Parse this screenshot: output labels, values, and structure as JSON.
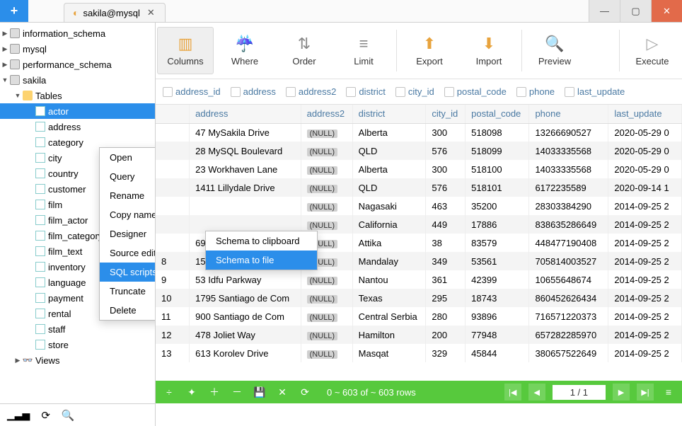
{
  "tab_title": "sakila@mysql",
  "sidebar": {
    "databases": [
      "information_schema",
      "mysql",
      "performance_schema",
      "sakila"
    ],
    "folder_tables": "Tables",
    "tables": [
      "actor",
      "address",
      "category",
      "city",
      "country",
      "customer",
      "film",
      "film_actor",
      "film_category",
      "film_text",
      "inventory",
      "language",
      "payment",
      "rental",
      "staff",
      "store"
    ],
    "folder_views": "Views"
  },
  "toolbar": {
    "columns": "Columns",
    "where": "Where",
    "order": "Order",
    "limit": "Limit",
    "export": "Export",
    "import": "Import",
    "preview": "Preview",
    "execute": "Execute"
  },
  "column_checks": [
    "address_id",
    "address",
    "address2",
    "district",
    "city_id",
    "postal_code",
    "phone",
    "last_update"
  ],
  "grid": {
    "headers": [
      "",
      "address",
      "address2",
      "district",
      "city_id",
      "postal_code",
      "phone",
      "last_update"
    ],
    "rows": [
      [
        "",
        "47 MySakila Drive",
        "(NULL)",
        "Alberta",
        "300",
        "518098",
        "13266690527",
        "2020-05-29 0"
      ],
      [
        "",
        "28 MySQL Boulevard",
        "(NULL)",
        "QLD",
        "576",
        "518099",
        "14033335568",
        "2020-05-29 0"
      ],
      [
        "",
        "23 Workhaven Lane",
        "(NULL)",
        "Alberta",
        "300",
        "518100",
        "14033335568",
        "2020-05-29 0"
      ],
      [
        "",
        "1411 Lillydale Drive",
        "(NULL)",
        "QLD",
        "576",
        "518101",
        "6172235589",
        "2020-09-14 1"
      ],
      [
        "",
        "",
        "(NULL)",
        "Nagasaki",
        "463",
        "35200",
        "28303384290",
        "2014-09-25 2"
      ],
      [
        "",
        "",
        "(NULL)",
        "California",
        "449",
        "17886",
        "838635286649",
        "2014-09-25 2"
      ],
      [
        "",
        "692 Joliet Street",
        "(NULL)",
        "Attika",
        "38",
        "83579",
        "448477190408",
        "2014-09-25 2"
      ],
      [
        "8",
        "1566 Inegl Manor",
        "(NULL)",
        "Mandalay",
        "349",
        "53561",
        "705814003527",
        "2014-09-25 2"
      ],
      [
        "9",
        "53 Idfu Parkway",
        "(NULL)",
        "Nantou",
        "361",
        "42399",
        "10655648674",
        "2014-09-25 2"
      ],
      [
        "10",
        "1795 Santiago de Com",
        "(NULL)",
        "Texas",
        "295",
        "18743",
        "860452626434",
        "2014-09-25 2"
      ],
      [
        "11",
        "900 Santiago de Com",
        "(NULL)",
        "Central Serbia",
        "280",
        "93896",
        "716571220373",
        "2014-09-25 2"
      ],
      [
        "12",
        "478 Joliet Way",
        "(NULL)",
        "Hamilton",
        "200",
        "77948",
        "657282285970",
        "2014-09-25 2"
      ],
      [
        "13",
        "613 Korolev Drive",
        "(NULL)",
        "Masqat",
        "329",
        "45844",
        "380657522649",
        "2014-09-25 2"
      ]
    ]
  },
  "context_menu": {
    "items": [
      "Open",
      "Query",
      "Rename",
      "Copy name",
      "Designer",
      "Source editor",
      "SQL scripts",
      "Truncate",
      "Delete"
    ],
    "submenu": [
      "Schema to clipboard",
      "Schema to file"
    ]
  },
  "status": {
    "rows_text": "0 ~ 603 of ~ 603 rows",
    "page_text": "1 / 1"
  }
}
